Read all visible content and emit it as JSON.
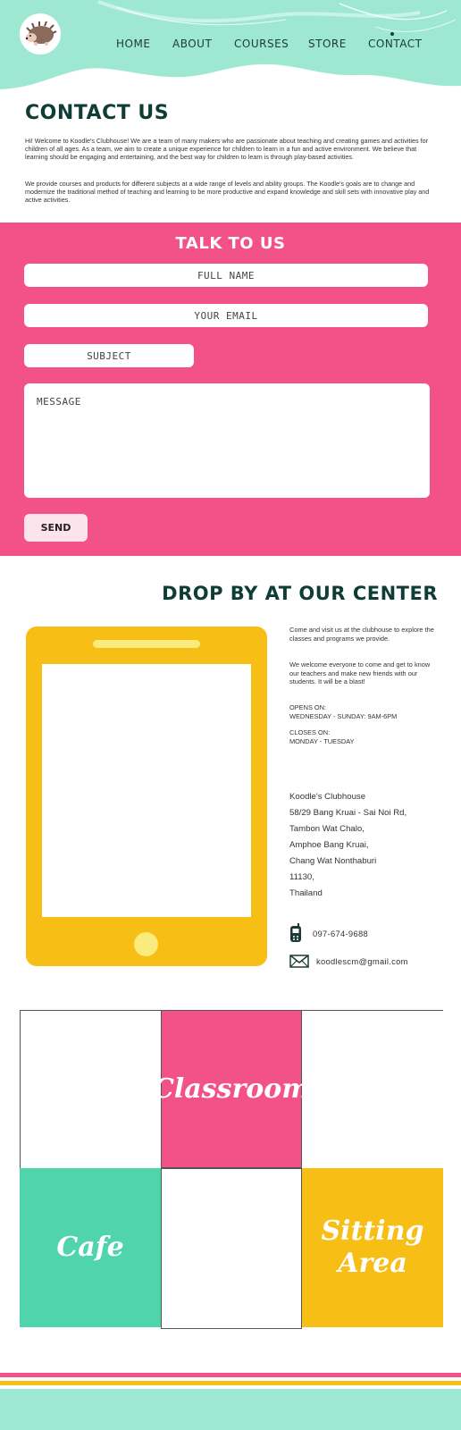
{
  "nav": {
    "logo_icon": "hedgehog-logo-icon",
    "items": [
      {
        "label": "HOME"
      },
      {
        "label": "ABOUT"
      },
      {
        "label": "COURSES"
      },
      {
        "label": "STORE"
      },
      {
        "label": "CONTACT"
      }
    ]
  },
  "contact": {
    "title": "CONTACT US",
    "paragraph1": "Hi! Welcome to Koodle's Clubhouse! We are a team of many makers who are passionate about teaching and creating games and activities for children of all ages. As a team, we aim to create a unique experience for children to learn in a fun and active environment. We believe that learning should be engaging and entertaining, and the best way for children to learn is through play-based activities.",
    "paragraph2": "We provide courses and products for different subjects at a wide range of levels and ability groups. The Koodle's goals are to change and modernize the traditional method of teaching and learning to be more productive and expand knowledge and skill sets with innovative play and active activities."
  },
  "form": {
    "title": "TALK TO US",
    "name_placeholder": "FULL NAME",
    "email_placeholder": "YOUR EMAIL",
    "subject_placeholder": "SUBJECT",
    "message_placeholder": "MESSAGE",
    "send_label": "SEND"
  },
  "visit": {
    "title": "DROP BY AT OUR CENTER",
    "line1": "Come and visit us at the clubhouse to explore the classes and programs we provide.",
    "line2": "We welcome everyone to come and get to know our teachers and make new friends with our students. It will be a blast!",
    "opens_label": "OPENS ON:",
    "opens_value": "WEDNESDAY - SUNDAY: 9AM-6PM",
    "closes_label": "CLOSES ON:",
    "closes_value": "MONDAY - TUESDAY",
    "address": [
      "Koodle's Clubhouse",
      "58/29 Bang Kruai - Sai Noi Rd,",
      "Tambon Wat Chalo,",
      "Amphoe Bang Kruai,",
      "Chang Wat Nonthaburi",
      "11130,",
      " Thailand"
    ],
    "phone": "097-674-9688",
    "email": "koodlescm@gmail.com",
    "phone_icon": "phone-icon",
    "mail_icon": "envelope-icon"
  },
  "gallery": {
    "classroom": "Classroom",
    "cafe": "Cafe",
    "sitting_line1": "Sitting",
    "sitting_line2": "Area"
  },
  "colors": {
    "mint": "#9ee8d2",
    "pink": "#f25287",
    "yellow": "#f7be16",
    "teal": "#4fd4ac",
    "dark_green": "#0f3d35"
  }
}
